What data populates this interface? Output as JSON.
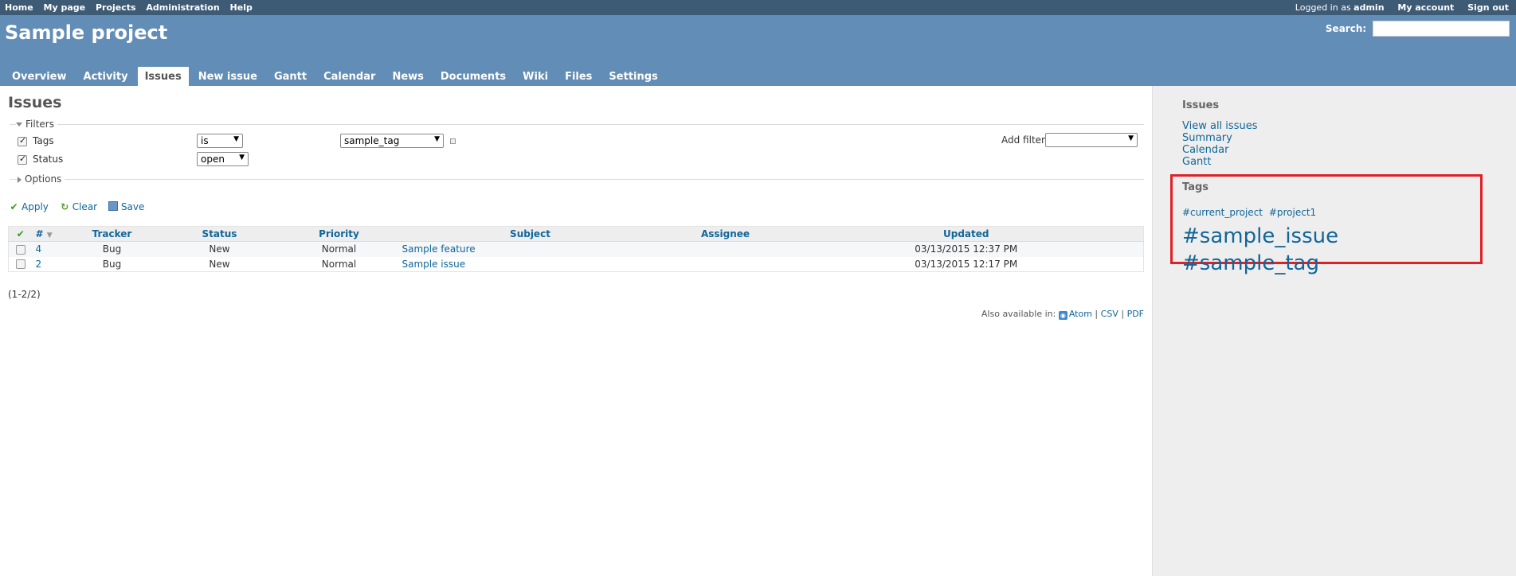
{
  "top_menu": {
    "left_links": [
      "Home",
      "My page",
      "Projects",
      "Administration",
      "Help"
    ],
    "logged_in_prefix": "Logged in as",
    "logged_in_user": "admin",
    "my_account": "My account",
    "sign_out": "Sign out"
  },
  "header": {
    "project_title": "Sample project",
    "search_label": "Search:",
    "search_value": ""
  },
  "main_menu": {
    "tabs": [
      "Overview",
      "Activity",
      "Issues",
      "New issue",
      "Gantt",
      "Calendar",
      "News",
      "Documents",
      "Wiki",
      "Files",
      "Settings"
    ],
    "selected": "Issues"
  },
  "content": {
    "title": "Issues",
    "filters_legend": "Filters",
    "filters": [
      {
        "label": "Tags",
        "checked": true,
        "operator": "is",
        "value": "sample_tag"
      },
      {
        "label": "Status",
        "checked": true,
        "operator": "open"
      }
    ],
    "add_filter_label": "Add filter",
    "add_filter_value": "",
    "options_legend": "Options",
    "actions": {
      "apply": "Apply",
      "clear": "Clear",
      "save": "Save"
    },
    "table": {
      "headers": {
        "id": "#",
        "tracker": "Tracker",
        "status": "Status",
        "priority": "Priority",
        "subject": "Subject",
        "assignee": "Assignee",
        "updated": "Updated"
      },
      "rows": [
        {
          "id": "4",
          "tracker": "Bug",
          "status": "New",
          "priority": "Normal",
          "subject": "Sample feature",
          "assignee": "",
          "updated": "03/13/2015 12:37 PM"
        },
        {
          "id": "2",
          "tracker": "Bug",
          "status": "New",
          "priority": "Normal",
          "subject": "Sample issue",
          "assignee": "",
          "updated": "03/13/2015 12:17 PM"
        }
      ]
    },
    "count": "(1-2/2)",
    "also_available": "Also available in:",
    "formats": [
      "Atom",
      "CSV",
      "PDF"
    ]
  },
  "sidebar": {
    "issues_heading": "Issues",
    "issue_links": [
      "View all issues",
      "Summary",
      "Calendar",
      "Gantt"
    ],
    "tags_heading": "Tags",
    "tags": [
      {
        "label": "#current_project",
        "size": "small"
      },
      {
        "label": "#project1",
        "size": "small"
      },
      {
        "label": "#sample_issue",
        "size": "large"
      },
      {
        "label": "#sample_tag",
        "size": "large"
      }
    ]
  },
  "colors": {
    "top_menu_bg": "#3e5b76",
    "header_bg": "#628db6",
    "link": "#169",
    "highlight_border": "#e02026",
    "sidebar_bg": "#eeeeee"
  }
}
